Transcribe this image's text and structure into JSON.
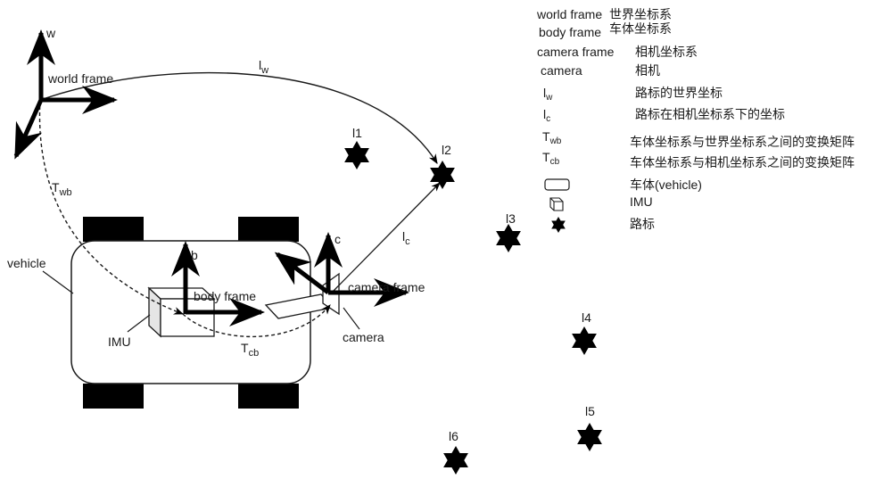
{
  "diagram": {
    "frames": {
      "world": {
        "axis_label": "w",
        "name": "world frame"
      },
      "body": {
        "axis_label": "b",
        "name": "body frame"
      },
      "camera": {
        "axis_label": "c",
        "name": "camera frame"
      }
    },
    "objects": {
      "vehicle": "vehicle",
      "imu": "IMU",
      "camera": "camera"
    },
    "transforms": {
      "lw": {
        "main": "l",
        "sub": "w"
      },
      "lc": {
        "main": "l",
        "sub": "c"
      },
      "twb": {
        "main": "T",
        "sub": "wb"
      },
      "tcb": {
        "main": "T",
        "sub": "cb"
      }
    },
    "landmarks": [
      "l1",
      "l2",
      "l3",
      "l4",
      "l5",
      "l6"
    ]
  },
  "legend": [
    {
      "key": "world frame",
      "value": "世界坐标系"
    },
    {
      "key": "body frame",
      "value": "车体坐标系"
    },
    {
      "key": "camera frame",
      "value": "相机坐标系"
    },
    {
      "key": "camera",
      "value": "相机"
    },
    {
      "key_main": "l",
      "key_sub": "w",
      "value": "路标的世界坐标"
    },
    {
      "key_main": "l",
      "key_sub": "c",
      "value": "路标在相机坐标系下的坐标"
    },
    {
      "key_main": "T",
      "key_sub": "wb",
      "value": "车体坐标系与世界坐标系之间的变换矩阵"
    },
    {
      "key_main": "T",
      "key_sub": "cb",
      "value": "车体坐标系与相机坐标系之间的变换矩阵"
    },
    {
      "key_icon": "rounded-rect-icon",
      "value": "车体(vehicle)"
    },
    {
      "key_icon": "cube-icon",
      "value": "IMU"
    },
    {
      "key_icon": "star-icon",
      "value": "路标"
    }
  ]
}
